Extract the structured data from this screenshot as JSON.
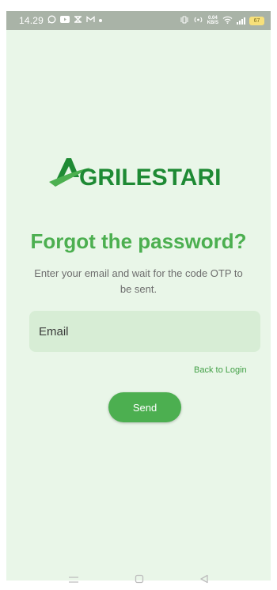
{
  "status_bar": {
    "time": "14.29",
    "speed_value": "0.04",
    "speed_unit": "KB/S",
    "battery": "67"
  },
  "app": {
    "brand_name": "AGRILESTARI",
    "brand_color": "#1e8a34",
    "accent_color": "#4caf50"
  },
  "forgot": {
    "title": "Forgot the password?",
    "subtitle": "Enter your email and wait for the code OTP to be sent.",
    "email_placeholder": "Email",
    "back_to_login": "Back to Login",
    "send_label": "Send"
  },
  "nav_bar": {
    "icons": [
      "menu-icon",
      "home-icon",
      "back-icon"
    ]
  }
}
